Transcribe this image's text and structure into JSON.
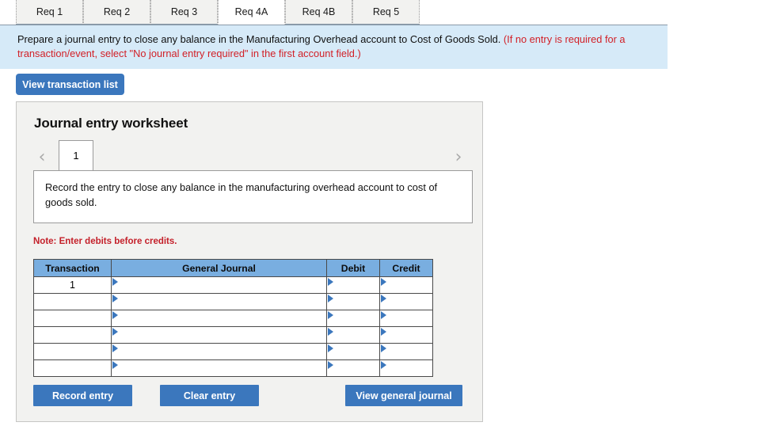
{
  "tabs": [
    {
      "label": "Req 1",
      "active": false
    },
    {
      "label": "Req 2",
      "active": false
    },
    {
      "label": "Req 3",
      "active": false
    },
    {
      "label": "Req 4A",
      "active": true
    },
    {
      "label": "Req 4B",
      "active": false
    },
    {
      "label": "Req 5",
      "active": false
    }
  ],
  "prompt": {
    "main": "Prepare a journal entry to close any balance in the Manufacturing Overhead account to Cost of Goods Sold.",
    "hint": "(If no entry is required for a transaction/event, select \"No journal entry required\" in the first account field.)"
  },
  "toolbar": {
    "view_transaction_list_label": "View transaction list"
  },
  "worksheet": {
    "title": "Journal entry worksheet",
    "pager": {
      "prev_icon": "chevron-left",
      "next_icon": "chevron-right",
      "pages": [
        "1"
      ],
      "current_page": "1"
    },
    "entry_description": "Record the entry to close any balance in the manufacturing overhead account to cost of goods sold.",
    "note": "Note: Enter debits before credits.",
    "table": {
      "headers": [
        "Transaction",
        "General Journal",
        "Debit",
        "Credit"
      ],
      "rows": [
        {
          "transaction": "1",
          "general_journal": "",
          "debit": "",
          "credit": ""
        },
        {
          "transaction": "",
          "general_journal": "",
          "debit": "",
          "credit": ""
        },
        {
          "transaction": "",
          "general_journal": "",
          "debit": "",
          "credit": ""
        },
        {
          "transaction": "",
          "general_journal": "",
          "debit": "",
          "credit": ""
        },
        {
          "transaction": "",
          "general_journal": "",
          "debit": "",
          "credit": ""
        },
        {
          "transaction": "",
          "general_journal": "",
          "debit": "",
          "credit": ""
        }
      ]
    },
    "actions": {
      "record_entry_label": "Record entry",
      "clear_entry_label": "Clear entry",
      "view_general_journal_label": "View general journal"
    }
  },
  "colors": {
    "accent_blue": "#3b77bd",
    "header_blue": "#79aee0",
    "banner_blue": "#d6eaf8",
    "warning_red": "#d22027",
    "panel_gray": "#f2f2f0"
  }
}
